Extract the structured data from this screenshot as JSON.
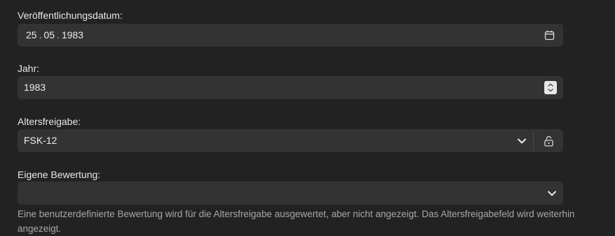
{
  "release_date": {
    "label": "Veröffentlichungsdatum:",
    "day": "25",
    "month": "05",
    "year": "1983",
    "separator": ".",
    "icon": "calendar-icon"
  },
  "year_field": {
    "label": "Jahr:",
    "value": "1983",
    "icon": "stepper-icon"
  },
  "age_rating": {
    "label": "Altersfreigabe:",
    "value": "FSK-12",
    "dropdown_icon": "chevron-down-icon",
    "lock_icon": "unlock-icon"
  },
  "custom_rating": {
    "label": "Eigene Bewertung:",
    "value": "",
    "dropdown_icon": "chevron-down-icon",
    "help": "Eine benutzerdefinierte Bewertung wird für die Altersfreigabe ausgewertet, aber nicht angezeigt. Das Altersfreigabefeld wird weiterhin angezeigt."
  },
  "colors": {
    "background": "#222222",
    "field_background": "#333333",
    "text": "#ececec",
    "help_text": "#a8a8a8"
  }
}
